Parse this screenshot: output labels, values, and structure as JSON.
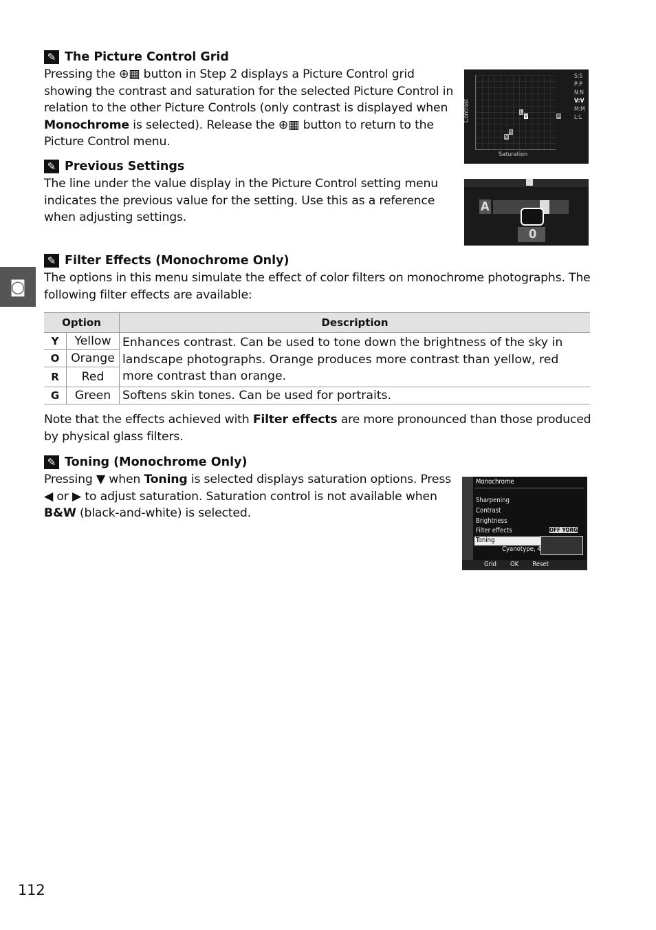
{
  "sections": [
    {
      "title": "The Picture Control Grid",
      "body_parts": [
        "Pressing the ",
        "⊕▦",
        " button in Step 2 displays a Picture Control grid showing the contrast and saturation for the selected Picture Control in relation to the other Picture Controls (only contrast is displayed when ",
        "Monochrome",
        " is selected).  Release the ",
        "⊕▦",
        " button to return to the Picture Control menu."
      ]
    },
    {
      "title": "Previous Settings",
      "body": "The line under the value display in the Picture Control setting menu indicates the previous value for the setting.  Use this as a reference when adjusting settings."
    },
    {
      "title": "Filter Effects (Monochrome Only)",
      "body": "The options in this menu simulate the effect of color filters on monochrome photographs.  The following filter effects are available:"
    },
    {
      "title": "Toning (Monochrome Only)",
      "body_parts": [
        "Pressing ",
        "▼",
        " when ",
        "Toning",
        " is selected displays saturation options.  Press ",
        "◀",
        " or ",
        "▶",
        " to adjust saturation.  Saturation control is not available when ",
        "B&W",
        " (black-and-white) is selected."
      ]
    }
  ],
  "table": {
    "headers": [
      "Option",
      "Description"
    ],
    "rows": [
      {
        "key": "Y",
        "name": "Yellow"
      },
      {
        "key": "O",
        "name": "Orange"
      },
      {
        "key": "R",
        "name": "Red"
      },
      {
        "key": "G",
        "name": "Green",
        "desc": "Softens skin tones.  Can be used for portraits."
      }
    ],
    "shared_desc": "Enhances contrast.  Can be used to tone down the brightness of the sky in landscape photographs.  Orange produces more contrast than yellow, red more contrast than orange."
  },
  "note_parts": [
    "Note that the effects achieved with ",
    "Filter effects",
    " are more pronounced than those produced by physical glass filters."
  ],
  "grid_screen": {
    "y_label": "Contrast",
    "x_label": "Saturation",
    "markers": [
      "L",
      "V",
      "S",
      "N",
      "M"
    ],
    "legend": [
      "S:S",
      "P:P",
      "N:N",
      "V:V",
      "M:M",
      "L:L"
    ]
  },
  "prev_screen": {
    "left": "A",
    "zero": "0"
  },
  "mono_screen": {
    "title": "Monochrome",
    "items": [
      "Sharpening",
      "Contrast",
      "Brightness",
      "Filter effects",
      "Toning"
    ],
    "toning_value": "Cyanotype, 4",
    "filter_options": "OFF YORG",
    "footer": [
      "Grid",
      "OK",
      "Reset"
    ]
  },
  "page_number": "112"
}
